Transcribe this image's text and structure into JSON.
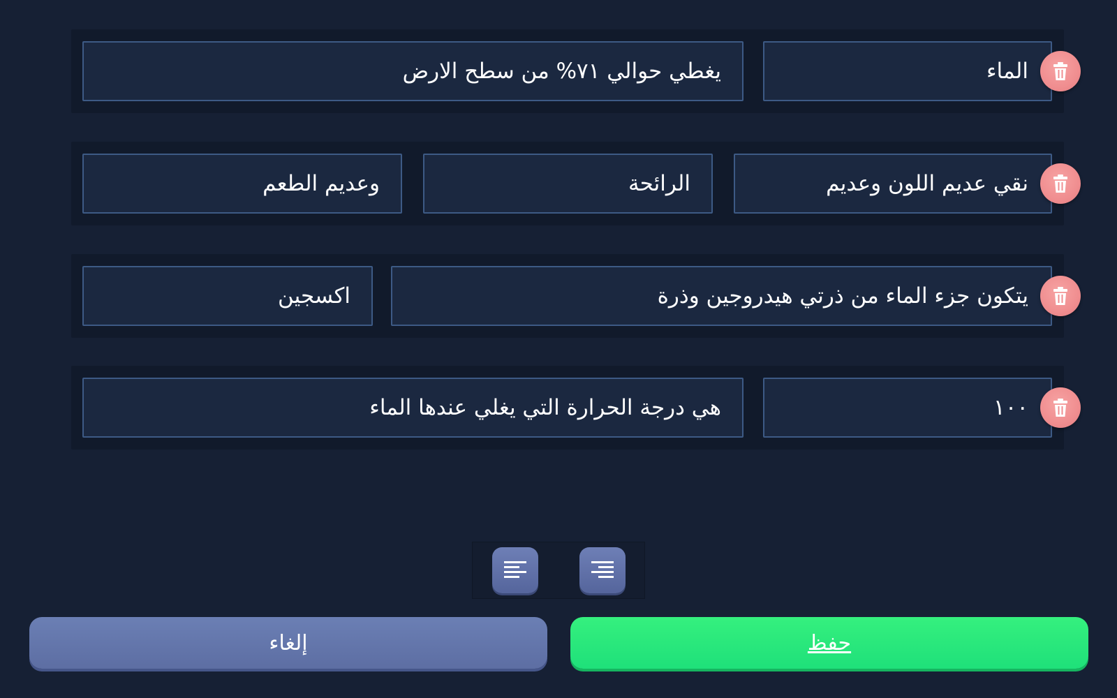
{
  "rows": [
    {
      "cells": [
        "الماء",
        "يغطي حوالي ٧١% من سطح الارض"
      ]
    },
    {
      "cells": [
        "نقي عديم اللون وعديم",
        "الرائحة",
        "وعديم الطعم"
      ]
    },
    {
      "cells": [
        "يتكون جزء الماء من ذرتي هيدروجين وذرة",
        "اكسجين"
      ]
    },
    {
      "cells": [
        "١٠٠",
        "هي درجة الحرارة التي يغلي عندها الماء"
      ]
    }
  ],
  "delete_icon": "trash-icon",
  "alignment": {
    "left_icon": "align-left-icon",
    "right_icon": "align-right-icon"
  },
  "buttons": {
    "cancel_label": "إلغاء",
    "save_label": "حفظ"
  },
  "colors": {
    "background": "#162034",
    "row_background": "#111a2b",
    "cell_background": "#1b2840",
    "cell_border": "#3d5a85",
    "delete_button": "#f08e90",
    "align_button": "#6373a9",
    "cancel_button": "#6676ab",
    "save_button": "#2ae87c"
  }
}
